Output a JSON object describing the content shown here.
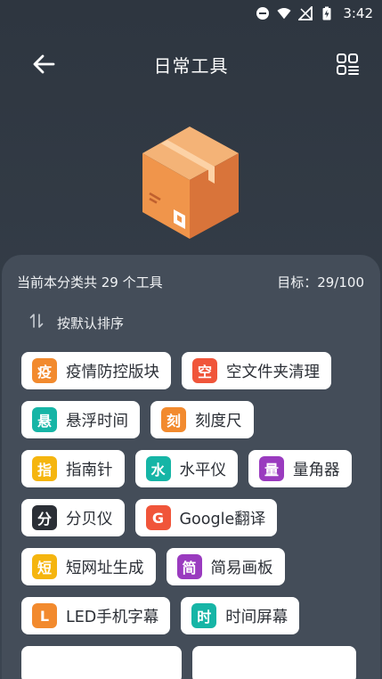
{
  "status_bar": {
    "time": "3:42",
    "icons": [
      "do-not-disturb-icon",
      "wifi-icon",
      "no-signal-icon",
      "battery-charging-icon"
    ]
  },
  "app_bar": {
    "title": "日常工具",
    "back_icon": "arrow-left-icon",
    "menu_icon": "grid-list-icon"
  },
  "illustration": {
    "name": "package-box-icon",
    "color": "#f0954b"
  },
  "panel": {
    "count_text": "当前本分类共 29 个工具",
    "goal_text": "目标：29/100",
    "sort_label": "按默认排序",
    "sort_icon": "sort-arrows-icon"
  },
  "tools": [
    [
      {
        "badge": "疫",
        "label": "疫情防控版块",
        "color": "#f28a2e"
      },
      {
        "badge": "空",
        "label": "空文件夹清理",
        "color": "#f0553a"
      }
    ],
    [
      {
        "badge": "悬",
        "label": "悬浮时间",
        "color": "#16b5a6"
      },
      {
        "badge": "刻",
        "label": "刻度尺",
        "color": "#f28a2e"
      }
    ],
    [
      {
        "badge": "指",
        "label": "指南针",
        "color": "#f5b50f"
      },
      {
        "badge": "水",
        "label": "水平仪",
        "color": "#16b5a6"
      },
      {
        "badge": "量",
        "label": "量角器",
        "color": "#9a3bbf"
      }
    ],
    [
      {
        "badge": "分",
        "label": "分贝仪",
        "color": "#2b2f36"
      },
      {
        "badge": "G",
        "label": "Google翻译",
        "color": "#f0553a"
      }
    ],
    [
      {
        "badge": "短",
        "label": "短网址生成",
        "color": "#f5b50f"
      },
      {
        "badge": "简",
        "label": "简易画板",
        "color": "#9a3bbf"
      }
    ],
    [
      {
        "badge": "L",
        "label": "LED手机字幕",
        "color": "#f28a2e"
      },
      {
        "badge": "时",
        "label": "时间屏幕",
        "color": "#16b5a6"
      }
    ]
  ]
}
